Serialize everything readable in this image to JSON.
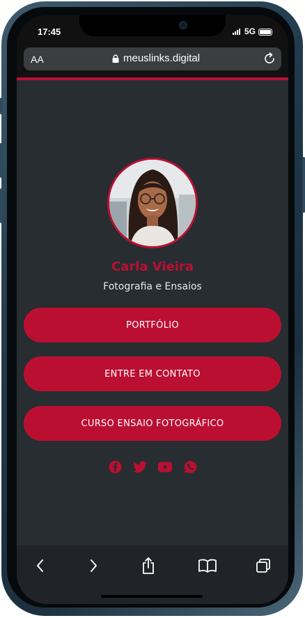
{
  "status_bar": {
    "time": "17:45",
    "network": "5G"
  },
  "browser": {
    "text_size_label": "AA",
    "url": "meuslinks.digital"
  },
  "profile": {
    "name": "Carla Vieira",
    "tagline": "Fotografia e Ensaios"
  },
  "links": [
    {
      "label": "PORTFÓLIO"
    },
    {
      "label": "ENTRE EM CONTATO"
    },
    {
      "label": "CURSO ENSAIO FOTOGRÁFICO"
    }
  ],
  "socials": [
    {
      "icon": "facebook-icon"
    },
    {
      "icon": "twitter-icon"
    },
    {
      "icon": "youtube-icon"
    },
    {
      "icon": "whatsapp-icon"
    }
  ],
  "toolbar": {
    "icons": [
      "back-icon",
      "forward-icon",
      "share-icon",
      "bookmarks-icon",
      "tabs-icon"
    ]
  },
  "colors": {
    "accent": "#bb0f32",
    "background": "#272d31",
    "toolbar": "#202428"
  }
}
